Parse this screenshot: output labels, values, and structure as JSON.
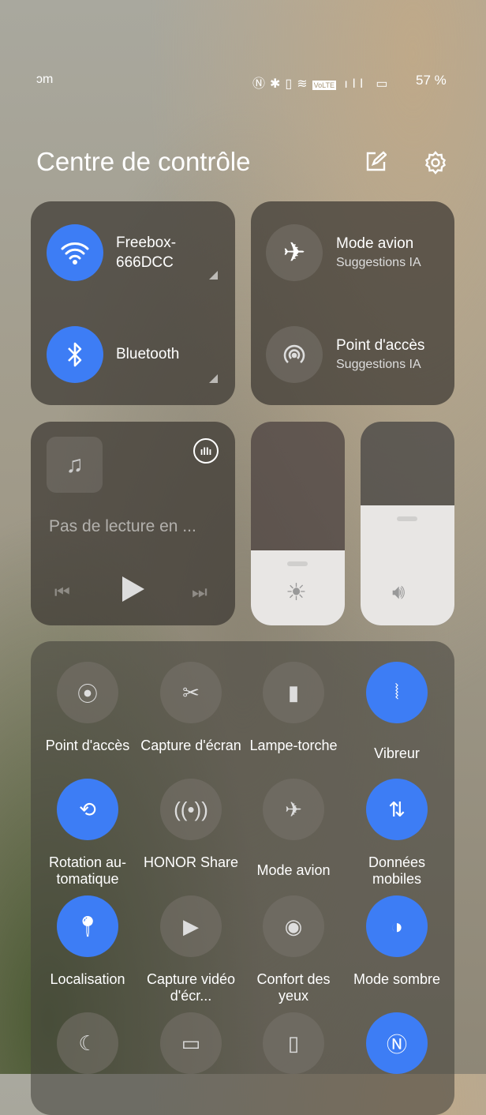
{
  "status_bar": {
    "left_text": "ɔm",
    "battery": "57 %",
    "icons": [
      "nfc-icon",
      "bluetooth-icon",
      "vibrate-icon",
      "wifi6-icon",
      "volte-icon",
      "signal-icon",
      "battery-icon"
    ],
    "volte": "VoLTE"
  },
  "header": {
    "title": "Centre de contrôle",
    "edit_icon": "edit-icon",
    "settings_icon": "gear-icon"
  },
  "connectivity": {
    "wifi": {
      "label": "Freebox-\n666DCC",
      "active": true
    },
    "bluetooth": {
      "label": "Bluetooth",
      "active": true
    }
  },
  "suggestions": [
    {
      "label": "Mode avion",
      "sub": "Suggestions IA"
    },
    {
      "label": "Point d'accès",
      "sub": "Suggestions IA"
    }
  ],
  "media": {
    "status": "Pas de lecture en ..."
  },
  "sliders": {
    "brightness": 0.37,
    "volume": 0.59
  },
  "colors": {
    "accent": "#3d7df5"
  },
  "tiles": [
    {
      "label": "Point d'accès",
      "active": false
    },
    {
      "label": "Capture d'écran",
      "active": false
    },
    {
      "label": "Lampe-torche",
      "active": false
    },
    {
      "label": "Vibreur",
      "active": true
    },
    {
      "label": "Rotation au-tomatique",
      "active": true
    },
    {
      "label": "HONOR Share",
      "active": false
    },
    {
      "label": "Mode avion",
      "active": false
    },
    {
      "label": "Données mobiles",
      "active": true
    },
    {
      "label": "Localisation",
      "active": true
    },
    {
      "label": "Capture vidéo d'écr...",
      "active": false
    },
    {
      "label": "Confort des yeux",
      "active": false
    },
    {
      "label": "Mode sombre",
      "active": true
    },
    {
      "label": "",
      "active": false
    },
    {
      "label": "",
      "active": false
    },
    {
      "label": "",
      "active": false
    },
    {
      "label": "",
      "active": true
    }
  ]
}
